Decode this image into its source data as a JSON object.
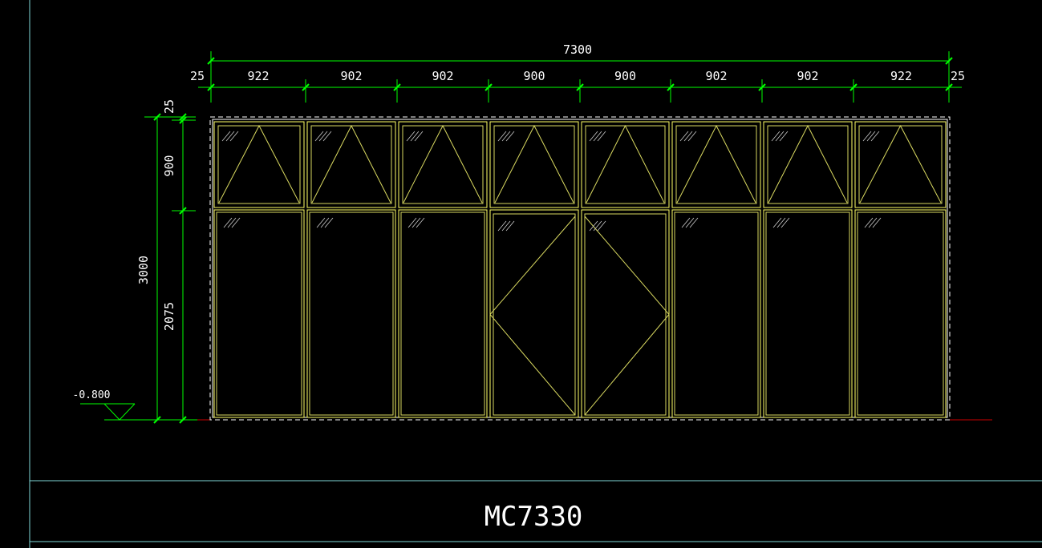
{
  "drawing": {
    "title": "MC7330",
    "overall_width_label": "7300",
    "segment_labels": [
      "25",
      "922",
      "902",
      "902",
      "900",
      "900",
      "902",
      "902",
      "922",
      "25"
    ],
    "height_labels": {
      "total": "3000",
      "top_margin": "25",
      "transom": "900",
      "lower": "2075"
    },
    "level_label": "-0.800",
    "colors": {
      "background": "#000000",
      "dimension": "#00ff00",
      "frame": "#ffffff",
      "glazing": "#ffff66",
      "border": "#7fd8d8",
      "ground": "#cc0000"
    }
  }
}
